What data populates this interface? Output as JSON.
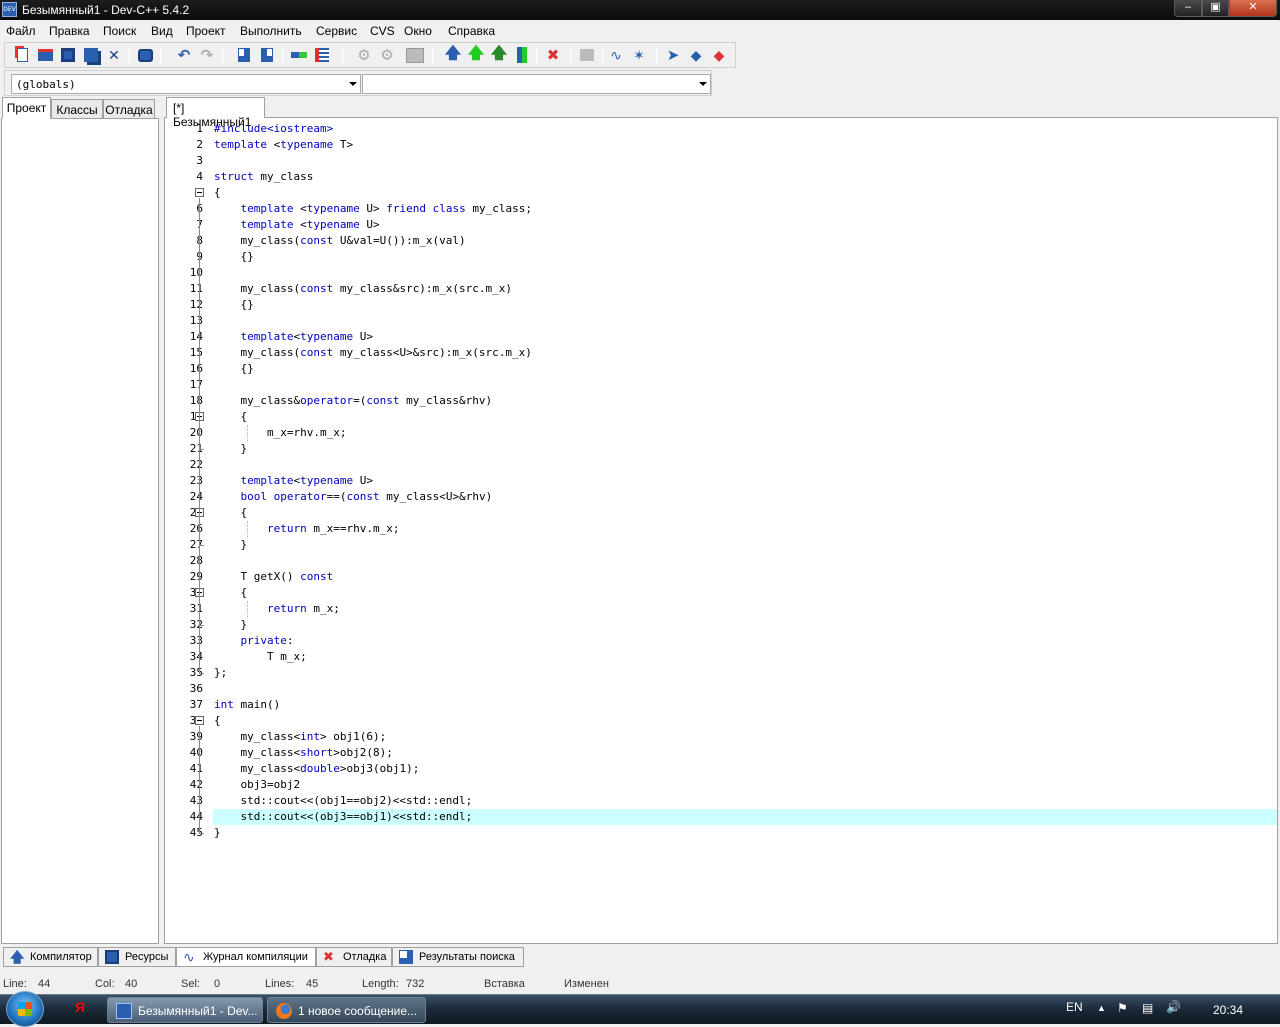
{
  "window": {
    "title": "Безымянный1 - Dev-C++ 5.4.2",
    "app_icon": "DEV"
  },
  "menu": [
    "Файл",
    "Правка",
    "Поиск",
    "Вид",
    "Проект",
    "Выполнить",
    "Сервис",
    "CVS",
    "Окно",
    "Справка"
  ],
  "toolbar": {
    "icons": [
      "new-file-icon",
      "open-icon",
      "save-icon",
      "save-all-icon",
      "close-icon",
      "print-icon",
      "undo-icon",
      "redo-icon",
      "find-icon",
      "replace-icon",
      "goto-icon",
      "toggle-bookmark-icon",
      "new-project-icon",
      "add-to-project-icon",
      "project-options-icon",
      "compile-icon",
      "run-icon",
      "compile-run-icon",
      "rebuild-icon",
      "debug-icon",
      "stop-icon",
      "add-watch-icon",
      "step-over-icon",
      "next-icon",
      "help-icon",
      "about-icon",
      "check-update-icon"
    ]
  },
  "scope": {
    "class_combo": "(globals)",
    "member_combo": ""
  },
  "left_tabs": [
    "Проект",
    "Классы",
    "Отладка"
  ],
  "editor": {
    "tab_label": "[*] Безымянный1",
    "current_line": 44,
    "lines": [
      "#include<iostream>",
      "template <typename T>",
      "",
      "struct my_class",
      "{",
      "    template <typename U> friend class my_class;",
      "    template <typename U>",
      "    my_class(const U&val=U()):m_x(val)",
      "    {}",
      "",
      "    my_class(const my_class&src):m_x(src.m_x)",
      "    {}",
      "",
      "    template<typename U>",
      "    my_class(const my_class<U>&src):m_x(src.m_x)",
      "    {}",
      "",
      "    my_class&operator=(const my_class&rhv)",
      "    {",
      "        m_x=rhv.m_x;",
      "    }",
      "",
      "    template<typename U>",
      "    bool operator==(const my_class<U>&rhv)",
      "    {",
      "        return m_x==rhv.m_x;",
      "    }",
      "",
      "    T getX() const",
      "    {",
      "        return m_x;",
      "    }",
      "    private:",
      "        T m_x;",
      "};",
      "",
      "int main()",
      "{",
      "    my_class<int> obj1(6);",
      "    my_class<short>obj2(8);",
      "    my_class<double>obj3(obj1);",
      "    obj3=obj2",
      "    std::cout<<(obj1==obj2)<<std::endl;",
      "    std::cout<<(obj3==obj1)<<std::endl;",
      "}"
    ]
  },
  "bottom_tabs": [
    {
      "label": "Компилятор",
      "icon": "compiler-icon"
    },
    {
      "label": "Ресурсы",
      "icon": "resources-icon"
    },
    {
      "label": "Журнал компиляции",
      "icon": "compile-log-icon"
    },
    {
      "label": "Отладка",
      "icon": "debug-icon"
    },
    {
      "label": "Результаты поиска",
      "icon": "search-results-icon"
    }
  ],
  "status": {
    "line_label": "Line:",
    "line": "44",
    "col_label": "Col:",
    "col": "40",
    "sel_label": "Sel:",
    "sel": "0",
    "lines_label": "Lines:",
    "lines": "45",
    "length_label": "Length:",
    "length": "732",
    "mode": "Вставка",
    "state": "Изменен"
  },
  "taskbar": {
    "quick_launch": "Я",
    "tasks": [
      {
        "label": "Безымянный1 - Dev...",
        "icon": "devcpp-icon"
      },
      {
        "label": "1 новое сообщение...",
        "icon": "firefox-icon"
      }
    ],
    "lang": "EN",
    "time": "20:34"
  },
  "colors": {
    "keyword": "#0000c0",
    "current_line": "#ccffff"
  }
}
